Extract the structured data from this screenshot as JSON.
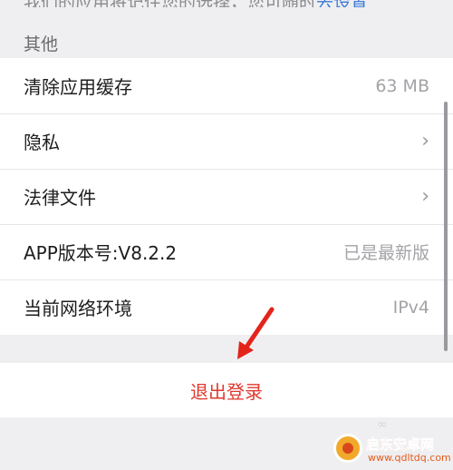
{
  "top_partial": {
    "text": "我们的应用将记住您的选择，您可随时",
    "link": "去设置"
  },
  "section_title": "其他",
  "rows": [
    {
      "label": "清除应用缓存",
      "value": "63 MB"
    },
    {
      "label": "隐私",
      "chevron": "›"
    },
    {
      "label": "法律文件",
      "chevron": "›"
    },
    {
      "label": "APP版本号:V8.2.2",
      "value": "已是最新版"
    },
    {
      "label": "当前网络环境",
      "value": "IPv4"
    }
  ],
  "logout_label": "退出登录",
  "faint_text": "∞",
  "watermark": {
    "text": "启东安卓网",
    "url": "www.qdltdq.com"
  },
  "colors": {
    "logout": "#e0392e",
    "arrow": "#e3241b",
    "background": "#efeff1"
  },
  "icons": {
    "chevron": "chevron-right-icon",
    "annotation": "red-arrow-icon"
  }
}
